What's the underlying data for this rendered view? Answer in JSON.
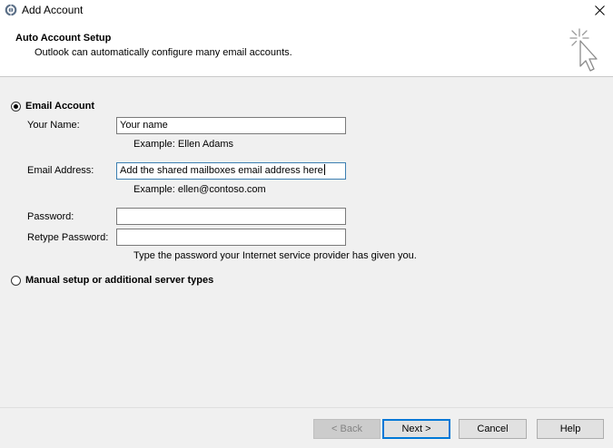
{
  "window": {
    "title": "Add Account"
  },
  "header": {
    "title": "Auto Account Setup",
    "subtitle": "Outlook can automatically configure many email accounts."
  },
  "options": {
    "email_account": {
      "label": "Email Account",
      "selected": true
    },
    "manual_setup": {
      "label": "Manual setup or additional server types",
      "selected": false
    }
  },
  "form": {
    "name": {
      "label": "Your Name:",
      "value": "Your name",
      "example": "Example: Ellen Adams"
    },
    "email": {
      "label": "Email Address:",
      "value": "Add the shared mailboxes email address here",
      "example": "Example: ellen@contoso.com"
    },
    "password": {
      "label": "Password:",
      "value": ""
    },
    "retype": {
      "label": "Retype Password:",
      "value": ""
    },
    "password_hint": "Type the password your Internet service provider has given you."
  },
  "buttons": {
    "back": "< Back",
    "next": "Next >",
    "cancel": "Cancel",
    "help": "Help"
  },
  "icons": {
    "app": "outlook-icon",
    "close": "close-icon",
    "header": "cursor-click-icon"
  }
}
